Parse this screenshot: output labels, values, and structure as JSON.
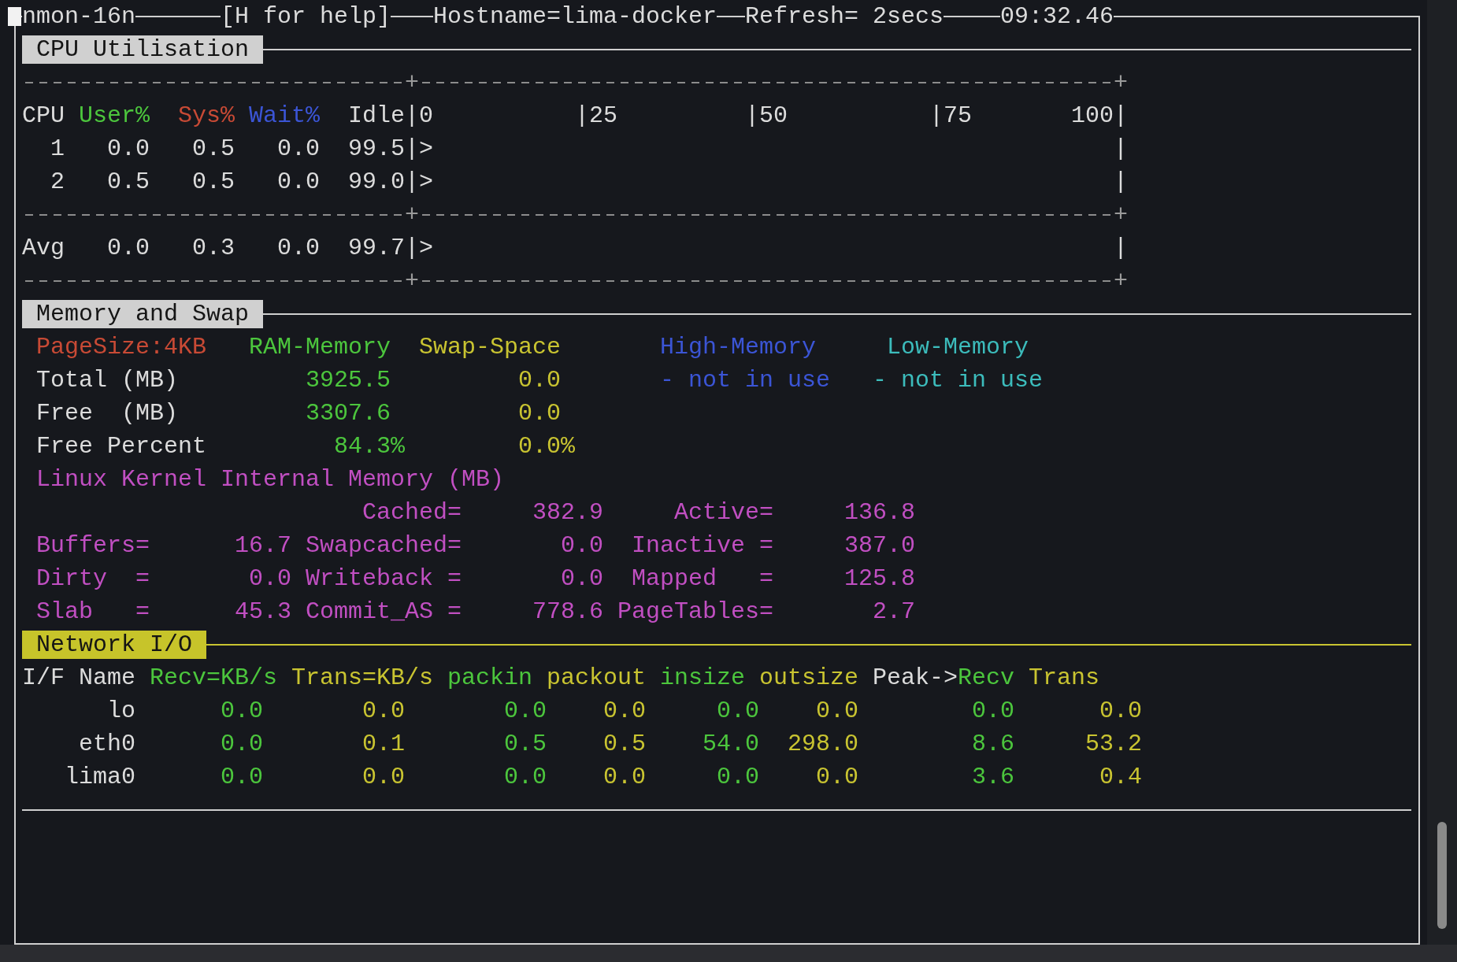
{
  "header": {
    "program": "nmon-16n",
    "help": "[H for help]",
    "hostname": "Hostname=lima-docker",
    "refresh": "Refresh= 2secs",
    "time": "09:32.46"
  },
  "cpu": {
    "title": "CPU Utilisation",
    "columns": [
      {
        "label": "CPU",
        "color": "#dcdcdc"
      },
      {
        "label": "User%",
        "color": "#4cc63d"
      },
      {
        "label": "Sys%",
        "color": "#c84a35"
      },
      {
        "label": "Wait%",
        "color": "#3b55d6"
      },
      {
        "label": "Idle",
        "color": "#dcdcdc"
      }
    ],
    "scale": [
      "|0",
      "|25",
      "|50",
      "|75",
      "100|"
    ],
    "separators": [
      [
        "+",
        "+"
      ],
      [
        "+",
        "+"
      ],
      [
        "+",
        "+"
      ]
    ],
    "rows": [
      {
        "cells": [
          "1",
          "0.0",
          "0.5",
          "0.0",
          "99.5"
        ],
        "bar": "|>",
        "edge": "|"
      },
      {
        "cells": [
          "2",
          "0.5",
          "0.5",
          "0.0",
          "99.0"
        ],
        "bar": "|>",
        "edge": "|"
      }
    ],
    "average": {
      "cells": [
        "Avg",
        "0.0",
        "0.3",
        "0.0",
        "99.7"
      ],
      "bar": "|>",
      "edge": "|"
    }
  },
  "memory": {
    "title": "Memory and Swap",
    "page_size": "PageSize:4KB",
    "columns": [
      {
        "label": "RAM-Memory",
        "color": "#4cc63d"
      },
      {
        "label": "Swap-Space",
        "color": "#c9c431"
      },
      {
        "label": "High-Memory",
        "color": "#3b55d6"
      },
      {
        "label": "Low-Memory",
        "color": "#3cbcbc"
      }
    ],
    "rows": [
      {
        "label": "Total (MB)",
        "values": [
          "3925.5",
          "0.0",
          "- not in use",
          "- not in use"
        ]
      },
      {
        "label": "Free  (MB)",
        "values": [
          "3307.6",
          "0.0"
        ]
      },
      {
        "label": "Free Percent",
        "values": [
          "84.3%",
          "0.0%"
        ]
      }
    ],
    "kernel": {
      "title": "Linux Kernel Internal Memory (MB)",
      "rows": [
        [
          {},
          {
            "label": "Cached=",
            "value": "382.9"
          },
          {
            "label": "Active=",
            "value": "136.8"
          }
        ],
        [
          {
            "label": "Buffers=",
            "value": "16.7"
          },
          {
            "label": "Swapcached=",
            "value": "0.0"
          },
          {
            "label": "Inactive =",
            "value": "387.0"
          }
        ],
        [
          {
            "label": "Dirty  =",
            "value": "0.0"
          },
          {
            "label": "Writeback =",
            "value": "0.0"
          },
          {
            "label": "Mapped   =",
            "value": "125.8"
          }
        ],
        [
          {
            "label": "Slab   =",
            "value": "45.3"
          },
          {
            "label": "Commit_AS =",
            "value": "778.6"
          },
          {
            "label": "PageTables=",
            "value": "2.7"
          }
        ]
      ]
    }
  },
  "network": {
    "title": "Network I/O",
    "name_header": "I/F Name",
    "peak_label": "Peak->",
    "columns": [
      {
        "label": "Recv=KB/s",
        "color": "#4cc63d"
      },
      {
        "label": "Trans=KB/s",
        "color": "#c9c431"
      },
      {
        "label": "packin",
        "color": "#4cc63d"
      },
      {
        "label": "packout",
        "color": "#c9c431"
      },
      {
        "label": "insize",
        "color": "#4cc63d"
      },
      {
        "label": "outsize",
        "color": "#c9c431"
      },
      {
        "label": "Recv",
        "color": "#4cc63d"
      },
      {
        "label": "Trans",
        "color": "#c9c431"
      }
    ],
    "rows": [
      {
        "name": "lo",
        "values": [
          "0.0",
          "0.0",
          "0.0",
          "0.0",
          "0.0",
          "0.0",
          "0.0",
          "0.0"
        ]
      },
      {
        "name": "eth0",
        "values": [
          "0.0",
          "0.1",
          "0.5",
          "0.5",
          "54.0",
          "298.0",
          "8.6",
          "53.2"
        ]
      },
      {
        "name": "lima0",
        "values": [
          "0.0",
          "0.0",
          "0.0",
          "0.0",
          "0.0",
          "0.0",
          "3.6",
          "0.4"
        ]
      }
    ]
  }
}
